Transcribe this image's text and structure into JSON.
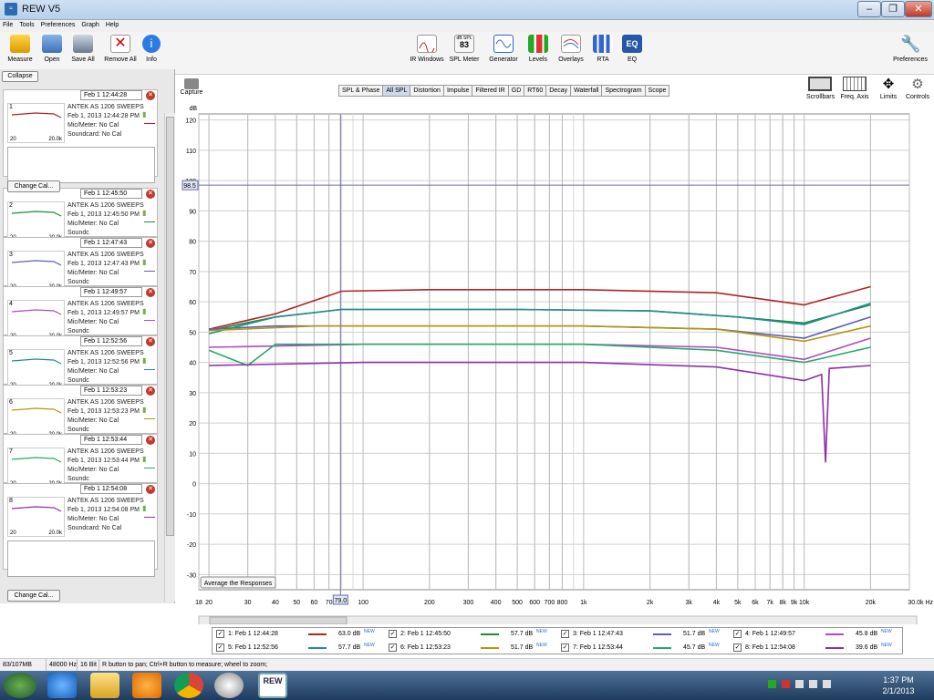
{
  "window": {
    "title": "REW V5",
    "controls": [
      "‒",
      "❐",
      "✕"
    ]
  },
  "menu": [
    "File",
    "Tools",
    "Preferences",
    "Graph",
    "Help"
  ],
  "toolbar": {
    "left": [
      {
        "label": "Measure",
        "icon": "measure-icon"
      },
      {
        "label": "Open",
        "icon": "open-folder-icon"
      },
      {
        "label": "Save All",
        "icon": "save-icon"
      },
      {
        "label": "Remove All",
        "icon": "remove-icon"
      },
      {
        "label": "Info",
        "icon": "info-icon"
      }
    ],
    "center": [
      {
        "label": "IR Windows",
        "icon": "ir-windows-icon"
      },
      {
        "label": "SPL Meter",
        "icon": "spl-meter-icon",
        "badge_top": "dB SPL",
        "badge_val": "83"
      },
      {
        "label": "Generator",
        "icon": "generator-icon"
      },
      {
        "label": "Levels",
        "icon": "levels-icon"
      },
      {
        "label": "Overlays",
        "icon": "overlays-icon"
      },
      {
        "label": "RTA",
        "icon": "rta-icon"
      },
      {
        "label": "EQ",
        "icon": "eq-icon",
        "badge_val": "EQ"
      }
    ],
    "preferences": "Preferences"
  },
  "sidebar": {
    "collapse": "Collapse",
    "change_cal": "Change Cal...",
    "thumb_left": "20",
    "thumb_right": "20.0k",
    "measurements": [
      {
        "date": "Feb 1 12:44:28",
        "line1": "ANTEK AS 1206 SWEEPS",
        "line2": "Feb 1, 2013 12:44:28 PM",
        "line3": "Mic/Meter: No Cal",
        "line4": "Soundcard: No Cal",
        "color": "#b22222",
        "idx": "1"
      },
      {
        "date": "Feb 1 12:45:50",
        "line1": "ANTEK AS 1206 SWEEPS",
        "line2": "Feb 1, 2013 12:45:50 PM",
        "line3": "Mic/Meter: No Cal",
        "line4": "Soundc",
        "color": "#1e8a3c",
        "idx": "2"
      },
      {
        "date": "Feb 1 12:47:43",
        "line1": "ANTEK AS 1206 SWEEPS",
        "line2": "Feb 1, 2013 12:47:43 PM",
        "line3": "Mic/Meter: No Cal",
        "line4": "Soundc",
        "color": "#5b5fb8",
        "idx": "3"
      },
      {
        "date": "Feb 1 12:49:57",
        "line1": "ANTEK AS 1206 SWEEPS",
        "line2": "Feb 1, 2013 12:49:57 PM",
        "line3": "Mic/Meter: No Cal",
        "line4": "Soundc",
        "color": "#b04ac0",
        "idx": "4"
      },
      {
        "date": "Feb 1 12:52:56",
        "line1": "ANTEK AS 1206 SWEEPS",
        "line2": "Feb 1, 2013 12:52:56 PM",
        "line3": "Mic/Meter: No Cal",
        "line4": "Soundc",
        "color": "#1f8f8f",
        "idx": "5"
      },
      {
        "date": "Feb 1 12:53:23",
        "line1": "ANTEK AS 1206 SWEEPS",
        "line2": "Feb 1, 2013 12:53:23 PM",
        "line3": "Mic/Meter: No Cal",
        "line4": "Soundc",
        "color": "#b8960c",
        "idx": "6"
      },
      {
        "date": "Feb 1 12:53:44",
        "line1": "ANTEK AS 1206 SWEEPS",
        "line2": "Feb 1, 2013 12:53:44 PM",
        "line3": "Mic/Meter: No Cal",
        "line4": "Soundc",
        "color": "#2aa86a",
        "idx": "7"
      },
      {
        "date": "Feb 1 12:54:08",
        "line1": "ANTEK AS 1206 SWEEPS",
        "line2": "Feb 1, 2013 12:54:08 PM",
        "line3": "Mic/Meter: No Cal",
        "line4": "Soundcard: No Cal",
        "color": "#8e2fa8",
        "idx": "8"
      }
    ]
  },
  "capture": "Capture",
  "tabs": [
    "SPL & Phase",
    "All SPL",
    "Distortion",
    "Impulse",
    "Filtered IR",
    "GD",
    "RT60",
    "Decay",
    "Waterfall",
    "Spectrogram",
    "Scope"
  ],
  "active_tab": "All SPL",
  "graph_controls": [
    "Scrollbars",
    "Freq. Axis",
    "Limits",
    "Controls"
  ],
  "average_button": "Average the Responses",
  "cursor": {
    "freq_label": "79.0",
    "level_label": "98.5"
  },
  "chart_data": {
    "type": "line",
    "ylabel": "dB",
    "xlabel": "Hz",
    "x_scale": "log",
    "ylim": [
      -35,
      122
    ],
    "xlim": [
      18,
      30000
    ],
    "grid": true,
    "yticks": [
      120,
      110,
      100,
      90,
      80,
      70,
      60,
      50,
      40,
      30,
      20,
      10,
      0,
      -10,
      -20,
      -30
    ],
    "xticks": [
      {
        "v": 18,
        "t": "18"
      },
      {
        "v": 20,
        "t": "20"
      },
      {
        "v": 30,
        "t": "30"
      },
      {
        "v": 40,
        "t": "40"
      },
      {
        "v": 50,
        "t": "50"
      },
      {
        "v": 60,
        "t": "60"
      },
      {
        "v": 70,
        "t": "70"
      },
      {
        "v": 100,
        "t": "100"
      },
      {
        "v": 200,
        "t": "200"
      },
      {
        "v": 300,
        "t": "300"
      },
      {
        "v": 400,
        "t": "400"
      },
      {
        "v": 500,
        "t": "500"
      },
      {
        "v": 600,
        "t": "600"
      },
      {
        "v": 700,
        "t": "700"
      },
      {
        "v": 800,
        "t": "800"
      },
      {
        "v": 1000,
        "t": "1k"
      },
      {
        "v": 2000,
        "t": "2k"
      },
      {
        "v": 3000,
        "t": "3k"
      },
      {
        "v": 4000,
        "t": "4k"
      },
      {
        "v": 5000,
        "t": "5k"
      },
      {
        "v": 6000,
        "t": "6k"
      },
      {
        "v": 7000,
        "t": "7k"
      },
      {
        "v": 8000,
        "t": "8k"
      },
      {
        "v": 9000,
        "t": "9k"
      },
      {
        "v": 10000,
        "t": "10k"
      },
      {
        "v": 20000,
        "t": "20k"
      },
      {
        "v": 30000,
        "t": "30.0k Hz"
      }
    ],
    "cursor_x": 79,
    "cursor_y": 98.5,
    "series": [
      {
        "name": "1: Feb 1 12:44:28",
        "level": "63.0 dB",
        "color": "#b22222",
        "points": [
          [
            20,
            51
          ],
          [
            40,
            56
          ],
          [
            80,
            63.5
          ],
          [
            200,
            64
          ],
          [
            1000,
            64
          ],
          [
            4000,
            63
          ],
          [
            10000,
            59
          ],
          [
            20000,
            65
          ]
        ]
      },
      {
        "name": "2: Feb 1 12:45:50",
        "level": "57.7 dB",
        "color": "#1e8a3c",
        "points": [
          [
            20,
            50.5
          ],
          [
            40,
            55
          ],
          [
            80,
            57.5
          ],
          [
            500,
            57.5
          ],
          [
            2000,
            57
          ],
          [
            5000,
            55
          ],
          [
            10000,
            53
          ],
          [
            20000,
            59
          ]
        ]
      },
      {
        "name": "3: Feb 1 12:47:43",
        "level": "51.7 dB",
        "color": "#5b5fb8",
        "points": [
          [
            20,
            51
          ],
          [
            40,
            52
          ],
          [
            200,
            52
          ],
          [
            1000,
            52
          ],
          [
            4000,
            51
          ],
          [
            10000,
            48
          ],
          [
            20000,
            55
          ]
        ]
      },
      {
        "name": "4: Feb 1 12:49:57",
        "level": "45.8 dB",
        "color": "#b04ac0",
        "points": [
          [
            20,
            45
          ],
          [
            100,
            46
          ],
          [
            1000,
            46
          ],
          [
            4000,
            45
          ],
          [
            10000,
            41
          ],
          [
            20000,
            48
          ]
        ]
      },
      {
        "name": "5: Feb 1 12:52:56",
        "level": "57.7 dB",
        "color": "#1f8f8f",
        "points": [
          [
            20,
            49.5
          ],
          [
            40,
            55
          ],
          [
            80,
            57.5
          ],
          [
            500,
            57.5
          ],
          [
            2000,
            57
          ],
          [
            5000,
            55
          ],
          [
            10000,
            52.5
          ],
          [
            20000,
            59.5
          ]
        ]
      },
      {
        "name": "6: Feb 1 12:53:23",
        "level": "51.7 dB",
        "color": "#b8960c",
        "points": [
          [
            20,
            50.5
          ],
          [
            60,
            52
          ],
          [
            300,
            52
          ],
          [
            1000,
            52
          ],
          [
            4000,
            51
          ],
          [
            10000,
            47
          ],
          [
            20000,
            52
          ]
        ]
      },
      {
        "name": "7: Feb 1 12:53:44",
        "level": "45.7 dB",
        "color": "#2aa86a",
        "points": [
          [
            20,
            44
          ],
          [
            30,
            39
          ],
          [
            40,
            46
          ],
          [
            100,
            46
          ],
          [
            1000,
            46
          ],
          [
            4000,
            44
          ],
          [
            10000,
            40
          ],
          [
            20000,
            45
          ]
        ]
      },
      {
        "name": "8: Feb 1 12:54:08",
        "level": "39.6 dB",
        "color": "#8e2fa8",
        "points": [
          [
            20,
            39
          ],
          [
            100,
            40
          ],
          [
            1000,
            40
          ],
          [
            4000,
            38.5
          ],
          [
            10000,
            34
          ],
          [
            12000,
            36
          ],
          [
            12500,
            7
          ],
          [
            13000,
            38
          ],
          [
            20000,
            39
          ]
        ]
      }
    ]
  },
  "legend_new": "NEW",
  "status": {
    "mem": "83/107MB",
    "rate": "48000 Hz",
    "bits": "16 Bit",
    "hint": "R button to pan; Ctrl+R button to measure; wheel to zoom;"
  },
  "taskbar": {
    "time": "1:37 PM",
    "date": "2/1/2013",
    "apps": [
      "ie-icon",
      "explorer-icon",
      "media-icon",
      "chrome-icon",
      "cd-icon",
      "rew-icon"
    ],
    "rew_label": "REW"
  }
}
